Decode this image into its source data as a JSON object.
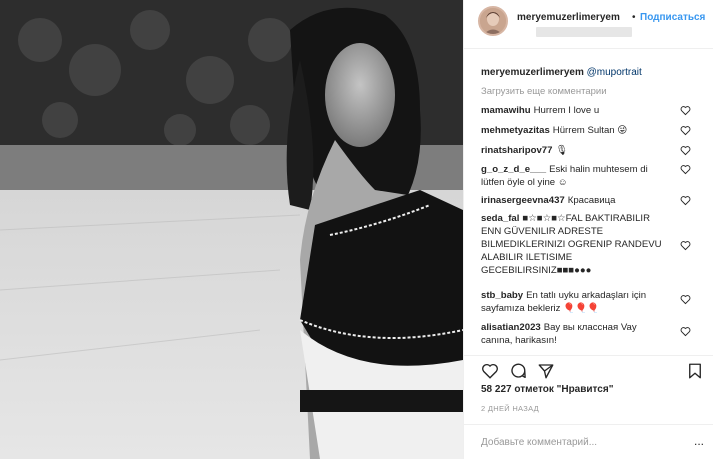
{
  "post": {
    "username": "meryemuzerlimeryem",
    "follow_label": "Подписаться",
    "dot": "•",
    "caption_user": "meryemuzerlimeryem",
    "caption_text": "@muportrait",
    "load_more": "Загрузить еще комментарии",
    "likes": "58 227 отметок \"Нравится\"",
    "posted": "2 ДНЕЙ НАЗАД",
    "add_comment_placeholder": "Добавьте комментарий...",
    "more_options": "..."
  },
  "comments": [
    {
      "user": "mamawihu",
      "text": "Hurrem I love u",
      "line2": ""
    },
    {
      "user": "mehmetyazitas",
      "text": "Hürrem Sultan 😜",
      "line2": ""
    },
    {
      "user": "rinatsharipov77",
      "text": "🎙",
      "line2": ""
    },
    {
      "user": "g_o_z_d_e___",
      "text": "Eski halin muhtesem di",
      "line2": "lütfen öyle ol yine ☺"
    },
    {
      "user": "irinasergeevna437",
      "text": "Красавица",
      "line2": ""
    },
    {
      "user": "seda_fal",
      "text": "■☆■☆■☆FAL BAKTIRABILIR",
      "line2": "ENN GÜVENILIR ADRESTE",
      "line3": "BILMEDIKLERINIZI OGRENIP RANDEVU",
      "line4": "ALABILIR ILETISIME",
      "line5": "GECEBILIRSINIZ■■■●●●"
    },
    {
      "user": "stb_baby",
      "text": "En tatlı uyku arkadaşları için",
      "line2": "sayfamıza bekleriz 🎈🎈🎈"
    },
    {
      "user": "alisatian2023",
      "text": "Вау вы классная Vay",
      "line2": "canına, harikasın!"
    }
  ],
  "icons": {
    "heart": "heart-icon",
    "comment": "comment-bubble-icon",
    "share": "share-icon",
    "bookmark": "bookmark-icon"
  },
  "colors": {
    "link": "#3897f0",
    "text": "#262626",
    "muted": "#999999",
    "border": "#efefef"
  }
}
